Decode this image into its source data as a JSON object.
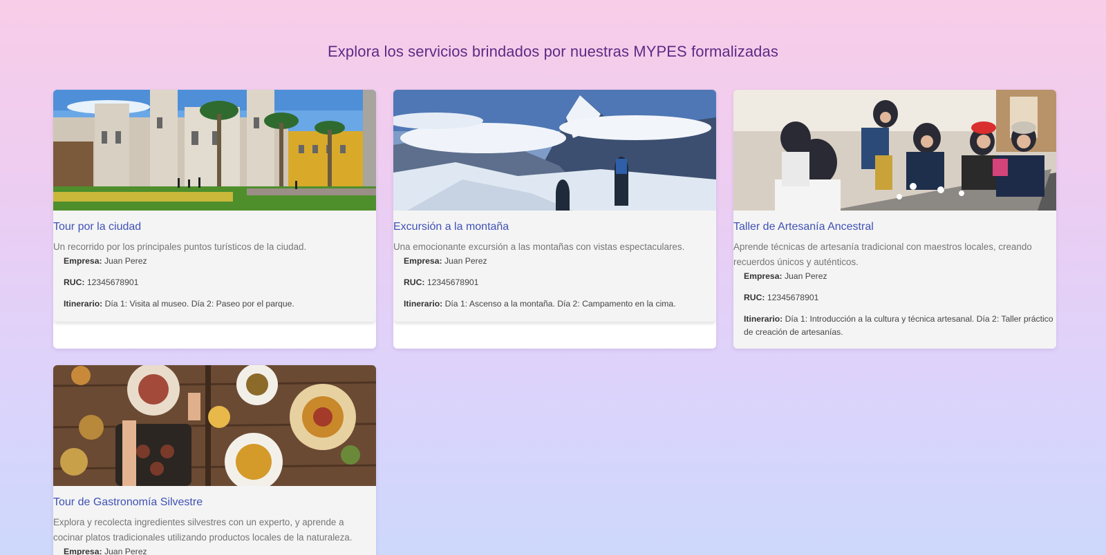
{
  "page": {
    "title": "Explora los servicios brindados por nuestras MYPES formalizadas"
  },
  "labels": {
    "empresa": "Empresa:",
    "ruc": "RUC:",
    "itinerario": "Itinerario:"
  },
  "cards": [
    {
      "title": "Tour por la ciudad",
      "description": "Un recorrido por los principales puntos turísticos de la ciudad.",
      "empresa": "Juan Perez",
      "ruc": "12345678901",
      "itinerario": "Día 1: Visita al museo. Día 2: Paseo por el parque.",
      "image": "city-cathedral-plaza"
    },
    {
      "title": "Excursión a la montaña",
      "description": "Una emocionante excursión a las montañas con vistas espectaculares.",
      "empresa": "Juan Perez",
      "ruc": "12345678901",
      "itinerario": "Día 1: Ascenso a la montaña. Día 2: Campamento en la cima.",
      "image": "snowy-mountain-hikers"
    },
    {
      "title": "Taller de Artesanía Ancestral",
      "description": "Aprende técnicas de artesanía tradicional con maestros locales, creando recuerdos únicos y auténticos.",
      "empresa": "Juan Perez",
      "ruc": "12345678901",
      "itinerario": "Día 1: Introducción a la cultura y técnica artesanal. Día 2: Taller práctico de creación de artesanías.",
      "image": "craft-workshop-group"
    },
    {
      "title": "Tour de Gastronomía Silvestre",
      "description": "Explora y recolecta ingredientes silvestres con un experto, y aprende a cocinar platos tradicionales utilizando productos locales de la naturaleza.",
      "empresa": "Juan Perez",
      "image": "food-table-dishes"
    }
  ]
}
